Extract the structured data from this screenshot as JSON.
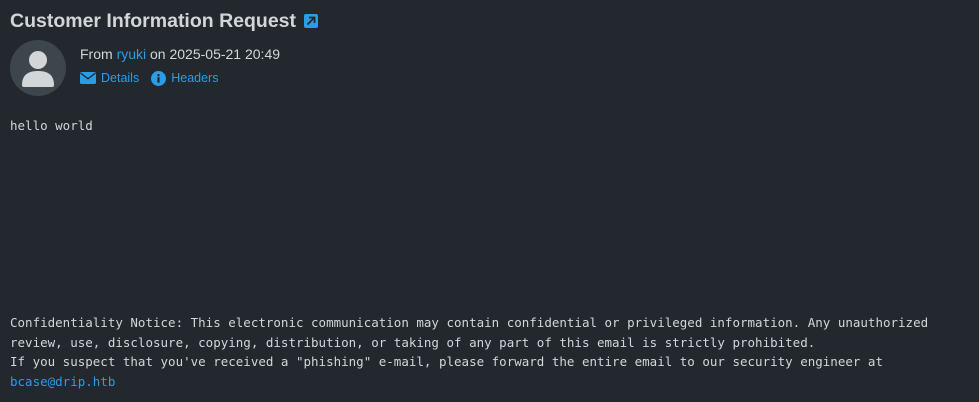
{
  "message": {
    "subject": "Customer Information Request",
    "from_prefix": "From",
    "sender": "ryuki",
    "on_word": "on",
    "date": "2025-05-21 20:49",
    "details_label": "Details",
    "headers_label": "Headers",
    "body": "hello world",
    "notice_line1": "Confidentiality Notice: This electronic communication may contain confidential or privileged information. Any unauthorized",
    "notice_line2": "review, use, disclosure, copying, distribution, or taking of any part of this email is strictly prohibited.",
    "notice_line3": "If you suspect that you've received a \"phishing\" e-mail, please forward the entire email to our security engineer at",
    "security_email": "bcase@drip.htb"
  },
  "colors": {
    "background": "#22282d",
    "text": "#d3d6d8",
    "accent": "#2b9de6"
  },
  "icons": {
    "popout": "external-window-icon",
    "avatar": "user-silhouette-icon",
    "details": "envelope-icon",
    "headers": "info-circle-icon"
  }
}
